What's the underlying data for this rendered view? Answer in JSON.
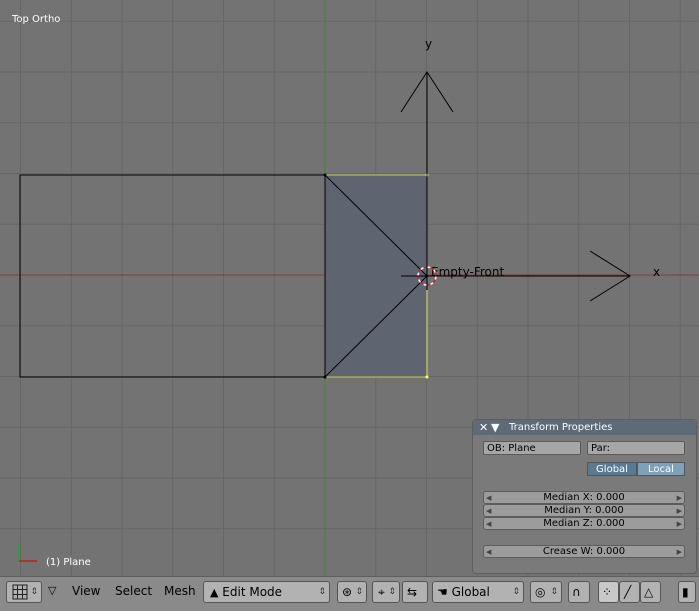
{
  "viewport": {
    "title": "Top Ortho",
    "object_label": "(1) Plane",
    "empty_label": "Empty-Front",
    "y_axis_label": "y",
    "x_axis_label": "x"
  },
  "transform_panel": {
    "title": "Transform Properties",
    "ob_field": "OB: Plane",
    "par_field": "Par:",
    "global_toggle": "Global",
    "local_toggle": "Local",
    "median_x": "Median X: 0.000",
    "median_y": "Median Y: 0.000",
    "median_z": "Median Z: 0.000",
    "crease_w": "Crease W: 0.000"
  },
  "header": {
    "menu_view": "View",
    "menu_select": "Select",
    "menu_mesh": "Mesh",
    "mode_select": "Edit Mode",
    "orientation_select": "Global"
  },
  "colors": {
    "viewport_bg": "#737373",
    "grid_line": "#666666",
    "x_axis": "#8c3a3a",
    "y_axis": "#2f8f2f",
    "selected_face": "#5f6570",
    "selected_edge": "#e0e060",
    "panel_header": "#5e6a78"
  }
}
